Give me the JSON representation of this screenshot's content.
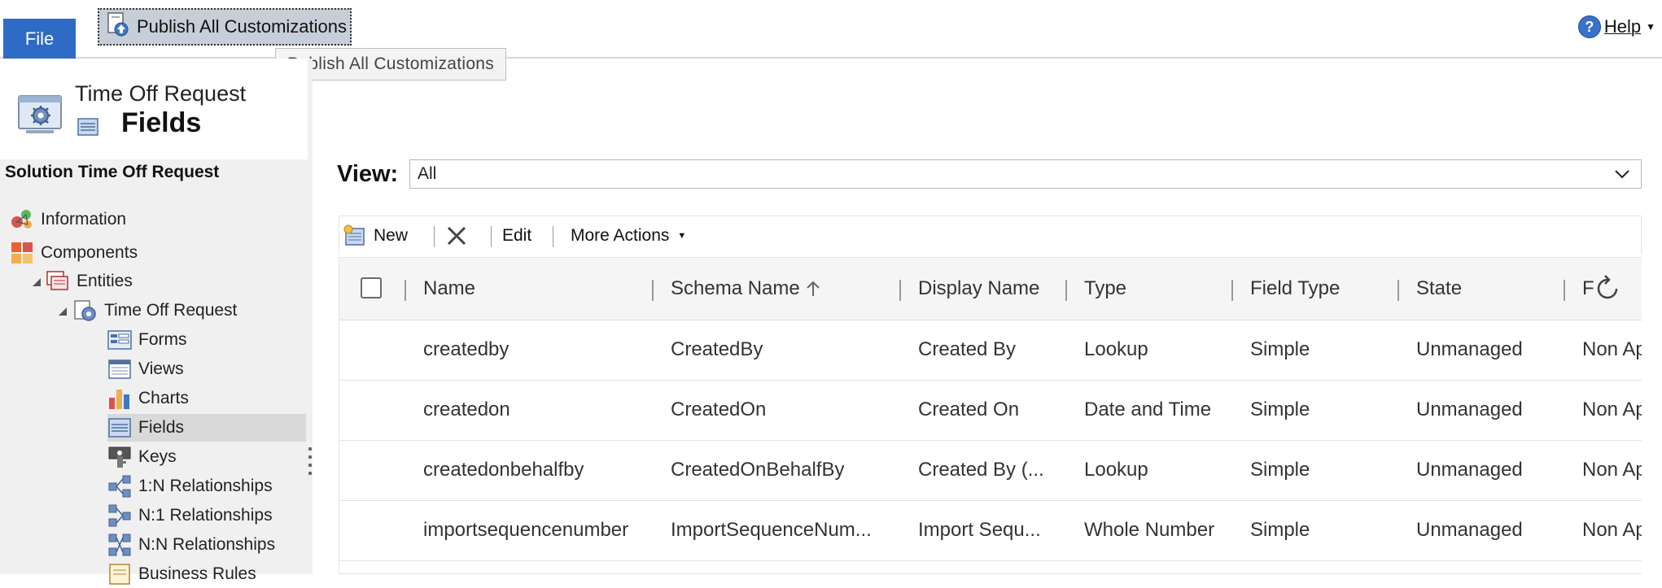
{
  "ribbon": {
    "file_label": "File",
    "publish_label": "Publish All Customizations",
    "tooltip": "Publish All Customizations",
    "help_label": "Help"
  },
  "nav": {
    "entity_title": "Time Off Request",
    "page_title": "Fields",
    "solution_label": "Solution Time Off Request",
    "items": [
      {
        "label": "Information",
        "icon": "information-icon"
      },
      {
        "label": "Components",
        "icon": "components-icon"
      },
      {
        "label": "Entities",
        "icon": "entities-icon"
      },
      {
        "label": "Time Off Request",
        "icon": "entity-icon"
      },
      {
        "label": "Forms",
        "icon": "forms-icon"
      },
      {
        "label": "Views",
        "icon": "views-icon"
      },
      {
        "label": "Charts",
        "icon": "charts-icon"
      },
      {
        "label": "Fields",
        "icon": "fields-icon"
      },
      {
        "label": "Keys",
        "icon": "keys-icon"
      },
      {
        "label": "1:N Relationships",
        "icon": "relationship-icon"
      },
      {
        "label": "N:1 Relationships",
        "icon": "relationship-icon"
      },
      {
        "label": "N:N Relationships",
        "icon": "relationship-icon"
      },
      {
        "label": "Business Rules",
        "icon": "business-rules-icon"
      }
    ]
  },
  "view": {
    "label": "View:",
    "selected": "All"
  },
  "toolbar": {
    "new_label": "New",
    "edit_label": "Edit",
    "more_label": "More Actions"
  },
  "grid": {
    "columns": [
      "Name",
      "Schema Name",
      "Display Name",
      "Type",
      "Field Type",
      "State",
      "F"
    ],
    "rows": [
      [
        "createdby",
        "CreatedBy",
        "Created By",
        "Lookup",
        "Simple",
        "Unmanaged",
        "Non Ap"
      ],
      [
        "createdon",
        "CreatedOn",
        "Created On",
        "Date and Time",
        "Simple",
        "Unmanaged",
        "Non Ap"
      ],
      [
        "createdonbehalfby",
        "CreatedOnBehalfBy",
        "Created By (...",
        "Lookup",
        "Simple",
        "Unmanaged",
        "Non Ap"
      ],
      [
        "importsequencenumber",
        "ImportSequenceNum...",
        "Import Sequ...",
        "Whole Number",
        "Simple",
        "Unmanaged",
        "Non Ap"
      ]
    ]
  },
  "colors": {
    "file_blue": "#2e6bc4",
    "selected_nav": "#d9d9d9",
    "nav_bg": "#f0f0f0"
  }
}
